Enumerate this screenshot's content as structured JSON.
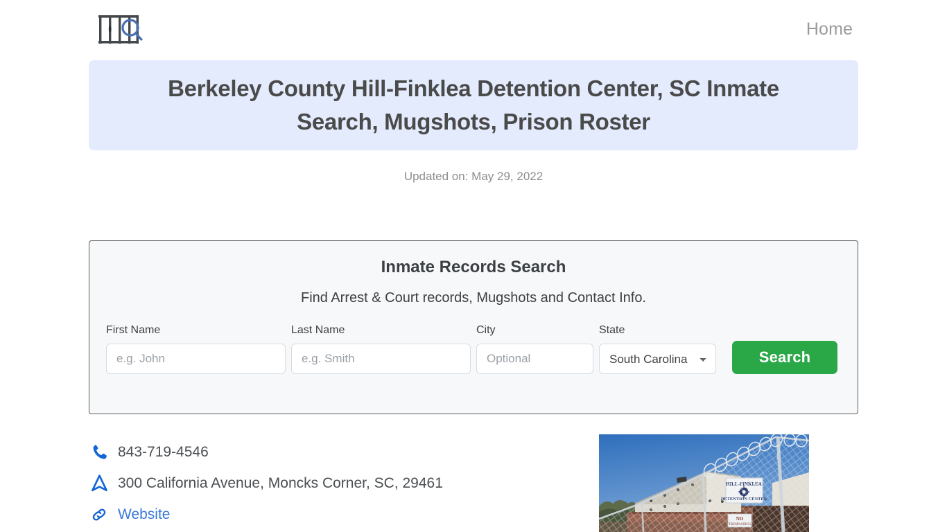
{
  "header": {
    "logo_name": "prison-bars-search-logo",
    "nav": [
      {
        "label": "Home"
      }
    ]
  },
  "banner": {
    "title": "Berkeley County Hill-Finklea Detention Center, SC Inmate Search, Mugshots, Prison Roster",
    "background_color": "#e3ebfd"
  },
  "updated": {
    "text": "Updated on: May 29, 2022"
  },
  "search_card": {
    "title": "Inmate Records Search",
    "subtitle": "Find Arrest & Court records, Mugshots and Contact Info.",
    "fields": {
      "first_name": {
        "label": "First Name",
        "value": "",
        "placeholder": "e.g. John"
      },
      "last_name": {
        "label": "Last Name",
        "value": "",
        "placeholder": "e.g. Smith"
      },
      "city": {
        "label": "City",
        "value": "",
        "placeholder": "Optional"
      },
      "state": {
        "label": "State",
        "selected": "South Carolina"
      }
    },
    "submit_label": "Search",
    "submit_color": "#2aa747"
  },
  "contact": {
    "phone": {
      "icon": "phone-icon",
      "text": "843-719-4546"
    },
    "address": {
      "icon": "navigation-arrow-icon",
      "text": "300 California Avenue, Moncks Corner, SC, 29461"
    },
    "website": {
      "icon": "link-icon",
      "text": "Website",
      "color": "#3c78d8"
    }
  },
  "photo": {
    "alt": "Hill-Finklea Detention Center exterior with chain-link fence and razor wire",
    "sign_text": "HILL-FINKLEA DETENTION CENTER",
    "notice_text": "NO TRESPASSING"
  }
}
